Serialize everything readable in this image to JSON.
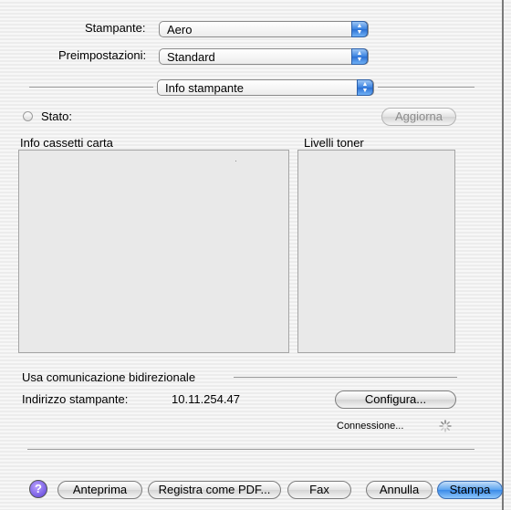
{
  "printer": {
    "label": "Stampante:",
    "value": "Aero"
  },
  "preset": {
    "label": "Preimpostazioni:",
    "value": "Standard"
  },
  "panel_menu": {
    "value": "Info stampante"
  },
  "status": {
    "label": "Stato:",
    "refresh_label": "Aggiorna"
  },
  "paper_trays": {
    "label": "Info cassetti carta"
  },
  "toner": {
    "label": "Livelli toner"
  },
  "bidirectional": {
    "label": "Usa comunicazione bidirezionale"
  },
  "address": {
    "label": "Indirizzo stampante:",
    "value": "10.11.254.47",
    "configure_label": "Configura..."
  },
  "connection": {
    "label": "Connessione..."
  },
  "buttons": {
    "help": "?",
    "preview": "Anteprima",
    "save_pdf": "Registra come PDF...",
    "fax": "Fax",
    "cancel": "Annulla",
    "print": "Stampa"
  },
  "colors": {
    "accent": "#3a8ae8",
    "background": "#f2f2f2"
  }
}
